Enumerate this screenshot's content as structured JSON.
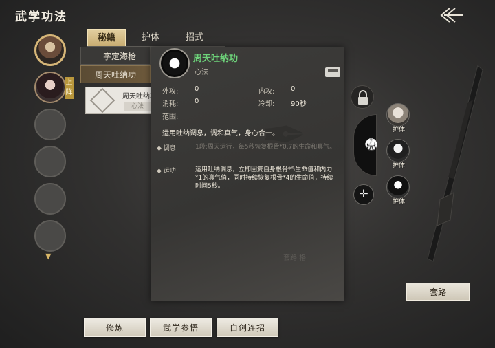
{
  "header": {
    "title": "武学功法"
  },
  "tabs": [
    {
      "label": "秘籍"
    },
    {
      "label": "护体"
    },
    {
      "label": "招式"
    }
  ],
  "roster": {
    "deploy_badge": "上阵"
  },
  "skill_list": [
    {
      "label": "一字定海枪"
    },
    {
      "label": "周天吐纳功"
    }
  ],
  "card": {
    "name": "周天吐纳功",
    "tag": "心法"
  },
  "detail": {
    "name": "周天吐纳功",
    "type": "心法",
    "stats": {
      "ext_attack_label": "外攻:",
      "ext_attack_value": "0",
      "int_attack_label": "内攻:",
      "int_attack_value": "0",
      "cost_label": "消耗:",
      "cost_value": "0",
      "cooldown_label": "冷却:",
      "cooldown_value": "90秒",
      "range_label": "范围:"
    },
    "description": "运用吐纳调息，调和真气，身心合一。",
    "effects": [
      {
        "label": "调息",
        "text": "1段:周天运行，每5秒恢复根骨*0.7的生命和真气。"
      },
      {
        "label": "运功",
        "text": "运用吐纳调息，立即回复自身根骨*5生命值和内力*1的真气值，同时持续恢复根骨*4的生命值，持续时间5秒。"
      }
    ]
  },
  "slots": [
    {
      "label": "护体"
    },
    {
      "label": "护体"
    },
    {
      "label": "护体"
    }
  ],
  "routine": {
    "hint": "套路  格",
    "button": "套路"
  },
  "bottom_buttons": {
    "train": "修炼",
    "comprehend": "武学参悟",
    "custom_combo": "自创连招"
  }
}
